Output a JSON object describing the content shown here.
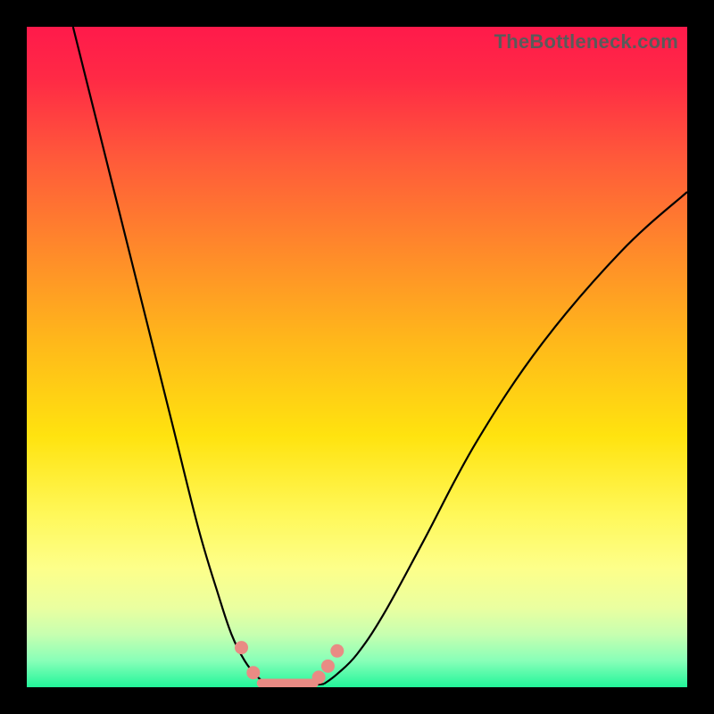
{
  "watermark": "TheBottleneck.com",
  "colors": {
    "background": "#000000",
    "gradient_top": "#ff1a4b",
    "gradient_bottom": "#22f59a",
    "curve": "#000000",
    "marker": "#e98b84"
  },
  "chart_data": {
    "type": "line",
    "title": "",
    "xlabel": "",
    "ylabel": "",
    "xlim": [
      0,
      100
    ],
    "ylim": [
      0,
      100
    ],
    "series": [
      {
        "name": "left-curve",
        "x": [
          7,
          10,
          14,
          18,
          22,
          26,
          29,
          31,
          33,
          35,
          36.5
        ],
        "y": [
          100,
          88,
          72,
          56,
          40,
          24,
          14,
          8,
          4,
          1.5,
          0.5
        ]
      },
      {
        "name": "right-curve",
        "x": [
          45,
          47,
          50,
          54,
          60,
          68,
          78,
          90,
          100
        ],
        "y": [
          0.5,
          2,
          5,
          11,
          22,
          37,
          52,
          66,
          75
        ]
      },
      {
        "name": "valley-floor",
        "x": [
          35,
          37,
          39,
          41,
          43,
          45
        ],
        "y": [
          0.5,
          0.3,
          0.3,
          0.3,
          0.3,
          0.5
        ]
      }
    ],
    "markers": [
      {
        "x": 32.5,
        "y": 6
      },
      {
        "x": 34.3,
        "y": 2.2
      },
      {
        "x": 44.2,
        "y": 1.5
      },
      {
        "x": 45.6,
        "y": 3.2
      },
      {
        "x": 47.0,
        "y": 5.5
      }
    ],
    "floor_segment": {
      "x0": 35.5,
      "x1": 43.5,
      "y": 0.6
    }
  }
}
